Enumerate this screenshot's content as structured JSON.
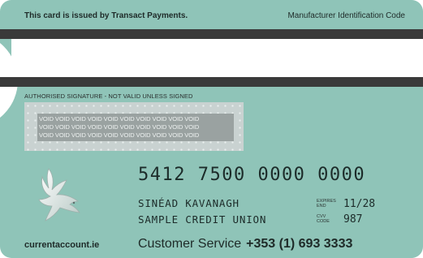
{
  "header": {
    "issuer_text": "This card is issued by Transact Payments.",
    "manufacturer_text": "Manufacturer Identification Code"
  },
  "signature": {
    "label": "AUTHORISED SIGNATURE - NOT VALID UNLESS SIGNED",
    "void_lines": [
      "VOID VOID VOID VOID VOID VOID VOID VOID VOID VOID",
      "VOID VOID VOID VOID VOID VOID VOID VOID VOID VOID",
      "VOID VOID VOID VOID VOID VOID VOID VOID VOID VOID"
    ]
  },
  "card": {
    "number": "5412 7500 0000 0000",
    "holder_name": "SINÉAD KAVANAGH",
    "credit_union": "SAMPLE CREDIT UNION",
    "expires_label_line1": "EXPIRES",
    "expires_label_line2": "END",
    "expiry": "11/28",
    "cvv_label_line1": "CVV",
    "cvv_label_line2": "CODE",
    "cvv": "987"
  },
  "footer": {
    "website": "currentaccount.ie",
    "customer_service_label": "Customer Service",
    "customer_service_number": "+353 (1) 693 3333"
  },
  "colors": {
    "card_background": "#8fc4b8",
    "stripe": "#3a3a3a",
    "signature_panel": "#c9d2d1"
  },
  "icons": {
    "logo": "dove-icon"
  }
}
